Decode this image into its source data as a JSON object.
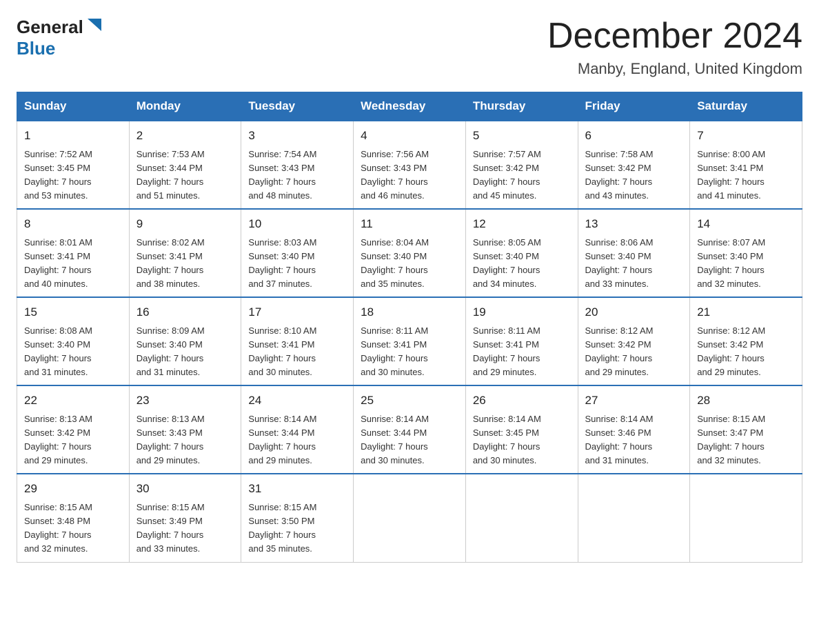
{
  "header": {
    "logo_general": "General",
    "logo_blue": "Blue",
    "title": "December 2024",
    "subtitle": "Manby, England, United Kingdom"
  },
  "days_of_week": [
    "Sunday",
    "Monday",
    "Tuesday",
    "Wednesday",
    "Thursday",
    "Friday",
    "Saturday"
  ],
  "weeks": [
    [
      {
        "day": "1",
        "sunrise": "7:52 AM",
        "sunset": "3:45 PM",
        "daylight": "7 hours and 53 minutes."
      },
      {
        "day": "2",
        "sunrise": "7:53 AM",
        "sunset": "3:44 PM",
        "daylight": "7 hours and 51 minutes."
      },
      {
        "day": "3",
        "sunrise": "7:54 AM",
        "sunset": "3:43 PM",
        "daylight": "7 hours and 48 minutes."
      },
      {
        "day": "4",
        "sunrise": "7:56 AM",
        "sunset": "3:43 PM",
        "daylight": "7 hours and 46 minutes."
      },
      {
        "day": "5",
        "sunrise": "7:57 AM",
        "sunset": "3:42 PM",
        "daylight": "7 hours and 45 minutes."
      },
      {
        "day": "6",
        "sunrise": "7:58 AM",
        "sunset": "3:42 PM",
        "daylight": "7 hours and 43 minutes."
      },
      {
        "day": "7",
        "sunrise": "8:00 AM",
        "sunset": "3:41 PM",
        "daylight": "7 hours and 41 minutes."
      }
    ],
    [
      {
        "day": "8",
        "sunrise": "8:01 AM",
        "sunset": "3:41 PM",
        "daylight": "7 hours and 40 minutes."
      },
      {
        "day": "9",
        "sunrise": "8:02 AM",
        "sunset": "3:41 PM",
        "daylight": "7 hours and 38 minutes."
      },
      {
        "day": "10",
        "sunrise": "8:03 AM",
        "sunset": "3:40 PM",
        "daylight": "7 hours and 37 minutes."
      },
      {
        "day": "11",
        "sunrise": "8:04 AM",
        "sunset": "3:40 PM",
        "daylight": "7 hours and 35 minutes."
      },
      {
        "day": "12",
        "sunrise": "8:05 AM",
        "sunset": "3:40 PM",
        "daylight": "7 hours and 34 minutes."
      },
      {
        "day": "13",
        "sunrise": "8:06 AM",
        "sunset": "3:40 PM",
        "daylight": "7 hours and 33 minutes."
      },
      {
        "day": "14",
        "sunrise": "8:07 AM",
        "sunset": "3:40 PM",
        "daylight": "7 hours and 32 minutes."
      }
    ],
    [
      {
        "day": "15",
        "sunrise": "8:08 AM",
        "sunset": "3:40 PM",
        "daylight": "7 hours and 31 minutes."
      },
      {
        "day": "16",
        "sunrise": "8:09 AM",
        "sunset": "3:40 PM",
        "daylight": "7 hours and 31 minutes."
      },
      {
        "day": "17",
        "sunrise": "8:10 AM",
        "sunset": "3:41 PM",
        "daylight": "7 hours and 30 minutes."
      },
      {
        "day": "18",
        "sunrise": "8:11 AM",
        "sunset": "3:41 PM",
        "daylight": "7 hours and 30 minutes."
      },
      {
        "day": "19",
        "sunrise": "8:11 AM",
        "sunset": "3:41 PM",
        "daylight": "7 hours and 29 minutes."
      },
      {
        "day": "20",
        "sunrise": "8:12 AM",
        "sunset": "3:42 PM",
        "daylight": "7 hours and 29 minutes."
      },
      {
        "day": "21",
        "sunrise": "8:12 AM",
        "sunset": "3:42 PM",
        "daylight": "7 hours and 29 minutes."
      }
    ],
    [
      {
        "day": "22",
        "sunrise": "8:13 AM",
        "sunset": "3:42 PM",
        "daylight": "7 hours and 29 minutes."
      },
      {
        "day": "23",
        "sunrise": "8:13 AM",
        "sunset": "3:43 PM",
        "daylight": "7 hours and 29 minutes."
      },
      {
        "day": "24",
        "sunrise": "8:14 AM",
        "sunset": "3:44 PM",
        "daylight": "7 hours and 29 minutes."
      },
      {
        "day": "25",
        "sunrise": "8:14 AM",
        "sunset": "3:44 PM",
        "daylight": "7 hours and 30 minutes."
      },
      {
        "day": "26",
        "sunrise": "8:14 AM",
        "sunset": "3:45 PM",
        "daylight": "7 hours and 30 minutes."
      },
      {
        "day": "27",
        "sunrise": "8:14 AM",
        "sunset": "3:46 PM",
        "daylight": "7 hours and 31 minutes."
      },
      {
        "day": "28",
        "sunrise": "8:15 AM",
        "sunset": "3:47 PM",
        "daylight": "7 hours and 32 minutes."
      }
    ],
    [
      {
        "day": "29",
        "sunrise": "8:15 AM",
        "sunset": "3:48 PM",
        "daylight": "7 hours and 32 minutes."
      },
      {
        "day": "30",
        "sunrise": "8:15 AM",
        "sunset": "3:49 PM",
        "daylight": "7 hours and 33 minutes."
      },
      {
        "day": "31",
        "sunrise": "8:15 AM",
        "sunset": "3:50 PM",
        "daylight": "7 hours and 35 minutes."
      },
      null,
      null,
      null,
      null
    ]
  ],
  "labels": {
    "sunrise": "Sunrise:",
    "sunset": "Sunset:",
    "daylight": "Daylight:"
  }
}
